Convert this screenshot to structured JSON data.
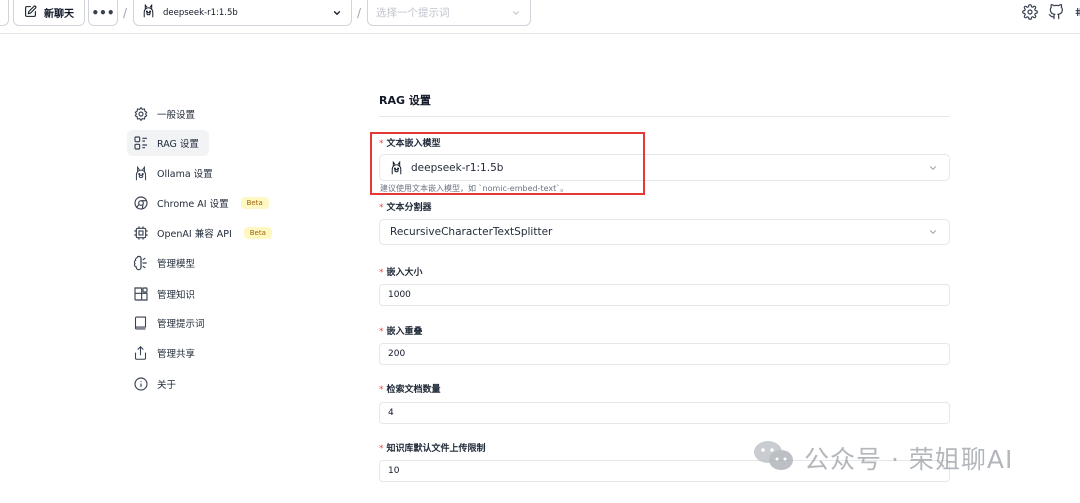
{
  "topbar": {
    "new_chat_label": "新聊天",
    "more_label": "•••",
    "separator": "/",
    "model_selected": "deepseek-r1:1.5b",
    "prompt_placeholder": "选择一个提示词"
  },
  "sidebar": {
    "items": [
      {
        "label": "一般设置",
        "icon": "settings-icon",
        "active": false,
        "badge": ""
      },
      {
        "label": "RAG 设置",
        "icon": "rag-icon",
        "active": true,
        "badge": ""
      },
      {
        "label": "Ollama 设置",
        "icon": "ollama-icon",
        "active": false,
        "badge": ""
      },
      {
        "label": "Chrome AI 设置",
        "icon": "chrome-icon",
        "active": false,
        "badge": "Beta"
      },
      {
        "label": "OpenAI 兼容 API",
        "icon": "cpu-icon",
        "active": false,
        "badge": "Beta"
      },
      {
        "label": "管理模型",
        "icon": "brain-icon",
        "active": false,
        "badge": ""
      },
      {
        "label": "管理知识",
        "icon": "blocks-icon",
        "active": false,
        "badge": ""
      },
      {
        "label": "管理提示词",
        "icon": "book-icon",
        "active": false,
        "badge": ""
      },
      {
        "label": "管理共享",
        "icon": "share-icon",
        "active": false,
        "badge": ""
      },
      {
        "label": "关于",
        "icon": "info-icon",
        "active": false,
        "badge": ""
      }
    ]
  },
  "main": {
    "title": "RAG 设置",
    "required_mark": "*",
    "embedding_model": {
      "label": "文本嵌入模型",
      "value": "deepseek-r1:1.5b",
      "hint": "建议使用文本嵌入模型，如 `nomic-embed-text`。"
    },
    "text_splitter": {
      "label": "文本分割器",
      "value": "RecursiveCharacterTextSplitter"
    },
    "chunk_size": {
      "label": "嵌入大小",
      "value": "1000"
    },
    "chunk_overlap": {
      "label": "嵌入重叠",
      "value": "200"
    },
    "retrieval_count": {
      "label": "检索文档数量",
      "value": "4"
    },
    "upload_limit": {
      "label": "知识库默认文件上传限制",
      "value": "10"
    }
  },
  "watermark": {
    "text": "公众号 · 荣姐聊AI"
  },
  "colors": {
    "highlight": "#e53935",
    "required": "#ef4444",
    "beta_bg": "#fef9c3",
    "beta_text": "#a16207"
  }
}
